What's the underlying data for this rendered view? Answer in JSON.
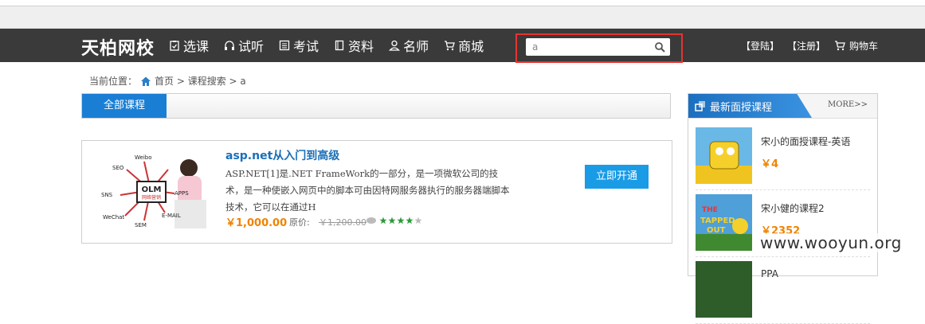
{
  "header": {
    "logo": "天柏网校",
    "nav": [
      {
        "label": "选课",
        "icon": "clipboard-check-icon"
      },
      {
        "label": "试听",
        "icon": "headphones-icon"
      },
      {
        "label": "考试",
        "icon": "document-list-icon"
      },
      {
        "label": "资料",
        "icon": "book-icon"
      },
      {
        "label": "名师",
        "icon": "user-icon"
      },
      {
        "label": "商城",
        "icon": "cart-icon"
      }
    ],
    "search": {
      "value": "a",
      "icon": "search-icon"
    },
    "login": "【登陆】",
    "register": "【注册】",
    "cart": "购物车"
  },
  "breadcrumb": {
    "prefix": "当前位置：",
    "home": "首页",
    "sep1": " > ",
    "search": "课程搜索",
    "sep2": " > ",
    "keyword": "a"
  },
  "tabs": {
    "active": "全部课程"
  },
  "course": {
    "title": "asp.net从入门到高级",
    "description": "ASP.NET[1]是.NET FrameWork的一部分，是一项微软公司的技术，是一种使嵌入网页中的脚本可由因特网服务器执行的服务器端脚本技术，它可以在通过H",
    "price": "￥1,000.00",
    "original_label": "原价:",
    "original_price": "￥1,200.00",
    "rating": 4,
    "button": "立即开通",
    "thumb_labels": {
      "center": "OLM",
      "sub": "网络营销",
      "seo": "SEO",
      "weibo": "Weibo",
      "sns": "SNS",
      "apps": "APPS",
      "wechat": "WeChat",
      "email": "E-MAIL",
      "sem": "SEM"
    }
  },
  "sidebar": {
    "title": "最新面授课程",
    "more": "MORE>>",
    "items": [
      {
        "name": "宋小的面授课程-英语",
        "price": "￥4"
      },
      {
        "name": "宋小健的课程2",
        "price": "￥2352"
      },
      {
        "name": "PPA",
        "price": ""
      }
    ]
  },
  "watermark": "www.wooyun.org",
  "colors": {
    "header_bg": "#3a3a3a",
    "accent_blue": "#1a7fd4",
    "price_orange": "#f08300",
    "highlight_red": "#e5342f"
  }
}
